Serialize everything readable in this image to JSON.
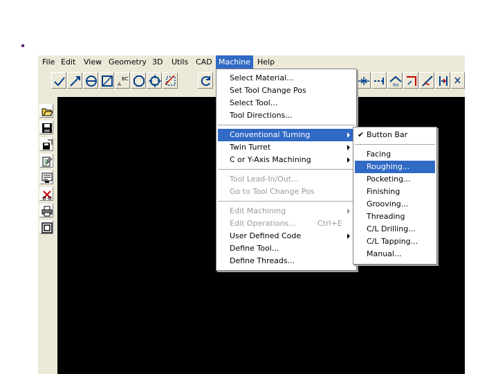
{
  "menubar": {
    "items": [
      "File",
      "Edit",
      "View",
      "Geometry",
      "3D",
      "Utils",
      "CAD",
      "Machine",
      "Help"
    ]
  },
  "toolbar": {
    "abc_top": "BC",
    "abc_bottom": "A",
    "rh_label": "RH"
  },
  "machine_menu": {
    "items": [
      {
        "label": "Select Material..."
      },
      {
        "label": "Set Tool Change Pos"
      },
      {
        "label": "Select Tool..."
      },
      {
        "label": "Tool Directions..."
      },
      {
        "label": "Conventional Turning"
      },
      {
        "label": "Twin Turret"
      },
      {
        "label": "C or Y-Axis Machining"
      },
      {
        "label": "Tool Lead-In/Out..."
      },
      {
        "label": "Go to Tool Change Pos"
      },
      {
        "label": "Edit Machining"
      },
      {
        "label": "Edit Operations...",
        "shortcut": "Ctrl+E"
      },
      {
        "label": "User Defined Code"
      },
      {
        "label": "Define Tool..."
      },
      {
        "label": "Define Threads..."
      }
    ]
  },
  "turning_submenu": {
    "items": [
      {
        "label": "Button Bar"
      },
      {
        "label": "Facing"
      },
      {
        "label": "Roughing..."
      },
      {
        "label": "Pocketing..."
      },
      {
        "label": "Finishing"
      },
      {
        "label": "Grooving..."
      },
      {
        "label": "Threading"
      },
      {
        "label": "C/L Drilling..."
      },
      {
        "label": "C/L Tapping..."
      },
      {
        "label": "Manual..."
      }
    ]
  },
  "colors": {
    "highlight": "#316ac5",
    "canvas": "#000000",
    "chrome": "#ece9d8",
    "bullet": "#5b2a86"
  }
}
